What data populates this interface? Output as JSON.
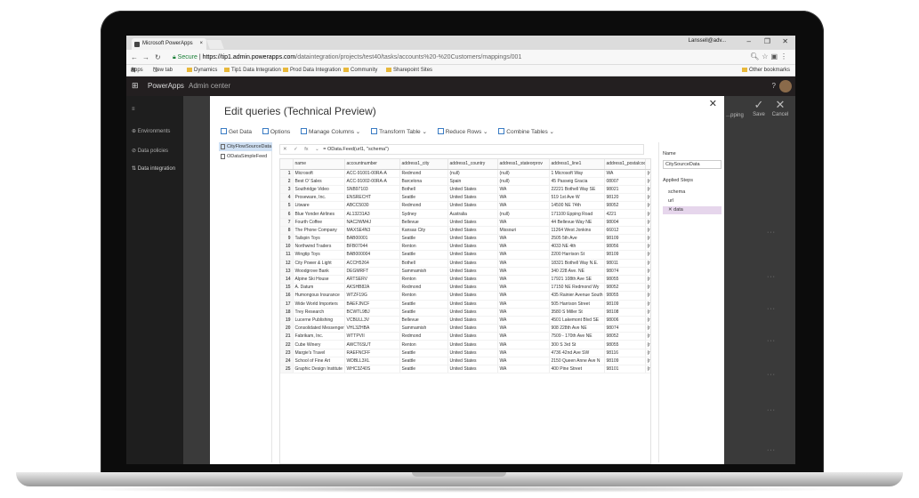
{
  "browser": {
    "tab_title": "Microsoft PowerApps",
    "tab_close": "×",
    "window_user": "Lanssell@adv...",
    "window_controls": {
      "minimize": "–",
      "maximize": "❐",
      "close": "✕"
    },
    "url_secure": "Secure",
    "url_host": "https://tip1.admin.powerapps.com",
    "url_path": "/dataintegration/projects/test40/tasks/accounts%20-%20Customers/mappings/001",
    "bookmarks": [
      "Apps",
      "New tab",
      "Dynamics",
      "Tip1 Data Integration",
      "Prod Data Integration",
      "Community",
      "Sharepoint Sites"
    ],
    "other_bookmarks": "Other bookmarks"
  },
  "app": {
    "brand": "PowerApps",
    "section": "Admin center",
    "help": "?"
  },
  "leftnav": {
    "items": [
      {
        "label": "Environments",
        "icon": "globe-icon"
      },
      {
        "label": "Data policies",
        "icon": "shield-icon"
      },
      {
        "label": "Data integration",
        "icon": "sync-icon"
      }
    ]
  },
  "actions": {
    "save": "Save",
    "cancel": "Cancel",
    "mapping": "...pping"
  },
  "dialog": {
    "title": "Edit queries (Technical Preview)",
    "close": "✕",
    "toolbar": [
      "Get Data",
      "Options",
      "Manage Columns ⌄",
      "Transform Table ⌄",
      "Reduce Rows ⌄",
      "Combine Tables ⌄"
    ],
    "queries": [
      "CityFlowSourceData",
      "ODataSimpleFeed"
    ],
    "formula": "= OData.Feed(url1, \"schema\")",
    "formula_controls": [
      "✕",
      "✓",
      "fx",
      "⌄"
    ],
    "columns": [
      "",
      "name",
      "accountnumber",
      "address1_city",
      "address1_country",
      "address1_stateorprov",
      "address1_line1",
      "address1_postalcode",
      ""
    ],
    "rows": [
      [
        "1",
        "Microsoft",
        "ACC-91001-00RA-A",
        "Redmond",
        "(null)",
        "(null)",
        "1 Microsoft Way",
        "WA",
        "(r"
      ],
      [
        "2",
        "Best O' Sales",
        "ACC-91002-00RA-A",
        "Barcelona",
        "Spain",
        "(null)",
        "45 Passeig Gracia",
        "08007",
        "(r"
      ],
      [
        "3",
        "Southridge Video",
        "SNB97103",
        "Bothell",
        "United States",
        "WA",
        "22221 Bothell Way SE",
        "98021",
        "(r"
      ],
      [
        "4",
        "Proseware, Inc.",
        "ENSRECHT",
        "Seattle",
        "United States",
        "WA",
        "519 1st Ave W",
        "98120",
        "(r"
      ],
      [
        "5",
        "Litware",
        "ABCC5030",
        "Redmond",
        "United States",
        "WA",
        "14500 NE 74th",
        "98052",
        "(r"
      ],
      [
        "6",
        "Blue Yonder Airlines",
        "AL13231A3",
        "Sydney",
        "Australia",
        "(null)",
        "171100 Epping Road",
        "4221",
        "(r"
      ],
      [
        "7",
        "Fourth Coffee",
        "NAC2WM4J",
        "Bellevue",
        "United States",
        "WA",
        "44 Bellevue Way NE",
        "98004",
        "(r"
      ],
      [
        "8",
        "The Phone Company",
        "MAXSE4N3",
        "Kansas City",
        "United States",
        "Missouri",
        "11264 West Jonkins",
        "66012",
        "(r"
      ],
      [
        "9",
        "Tailspin Toys",
        "BAB00001",
        "Seattle",
        "United States",
        "WA",
        "2505 5th Ave",
        "98109",
        "(r"
      ],
      [
        "10",
        "Northwind Traders",
        "BFB07044",
        "Renton",
        "United States",
        "WA",
        "4033 NE 4th",
        "98056",
        "(r"
      ],
      [
        "11",
        "Wingtip Toys",
        "BAB000004",
        "Seattle",
        "United States",
        "WA",
        "2200 Harrison St",
        "98109",
        "(r"
      ],
      [
        "12",
        "City Power & Light",
        "ACCH5264",
        "Bothell",
        "United States",
        "WA",
        "18321 Bothell Way N.E.",
        "98011",
        "(r"
      ],
      [
        "13",
        "Woodgrove Bank",
        "DEGMRFT",
        "Sammamish",
        "United States",
        "WA",
        "340 228 Ave. NE",
        "98074",
        "(r"
      ],
      [
        "14",
        "Alpine Ski House",
        "ARTSERV",
        "Renton",
        "United States",
        "WA",
        "17921 108th Ave SE",
        "98055",
        "(r"
      ],
      [
        "15",
        "A. Datum",
        "AKSHB82A",
        "Redmond",
        "United States",
        "WA",
        "17150 NE Redmond Wy",
        "98052",
        "(r"
      ],
      [
        "16",
        "Humongous Insurance",
        "WTZF19G",
        "Renton",
        "United States",
        "WA",
        "435 Rainier Avenue South",
        "98055",
        "(r"
      ],
      [
        "17",
        "Wide World Importers",
        "BAEFJNCF",
        "Seattle",
        "United States",
        "WA",
        "505 Harrison Street",
        "98109",
        "(r"
      ],
      [
        "18",
        "Trey Research",
        "BCWTL9BJ",
        "Seattle",
        "United States",
        "WA",
        "3580 S Miller St",
        "98108",
        "(r"
      ],
      [
        "19",
        "Lucerne Publishing",
        "VCBULL3V",
        "Bellevue",
        "United States",
        "WA",
        "4501 Lakemont Blvd SE",
        "98006",
        "(r"
      ],
      [
        "20",
        "Consolidated Messenger",
        "VHL3ZHBA",
        "Sammamish",
        "United States",
        "WA",
        "908 228th Ave NE",
        "98074",
        "(r"
      ],
      [
        "21",
        "Fabrikam, Inc.",
        "WTTPVII",
        "Redmond",
        "United States",
        "WA",
        "7509 - 170th Ave NE",
        "98052",
        "(r"
      ],
      [
        "22",
        "Cube Winery",
        "AWCT6SUT",
        "Renton",
        "United States",
        "WA",
        "300 S 3rd St",
        "98055",
        "(r"
      ],
      [
        "23",
        "Margie's Travel",
        "RAEFNCFF",
        "Seattle",
        "United States",
        "WA",
        "4736 42nd Ave SW",
        "98116",
        "(r"
      ],
      [
        "24",
        "School of Fine Art",
        "WDBLL3XL",
        "Seattle",
        "United States",
        "WA",
        "2150 Queen Anne Ave N",
        "98109",
        "(r"
      ],
      [
        "25",
        "Graphic Design Institute",
        "WHC3Z40S",
        "Seattle",
        "United States",
        "WA",
        "400 Pine Street",
        "98101",
        "(r"
      ]
    ],
    "right_pane": {
      "name_label": "Name",
      "name_value": "CitySourceData",
      "steps_label": "Applied Steps",
      "steps": [
        "schema",
        "url",
        "data"
      ],
      "selected_step": 2
    }
  },
  "colors": {
    "accent": "#3a7cc4",
    "selected_query": "#cfe0f3",
    "selected_step": "#e6d6ec",
    "shell": "#231f20"
  }
}
